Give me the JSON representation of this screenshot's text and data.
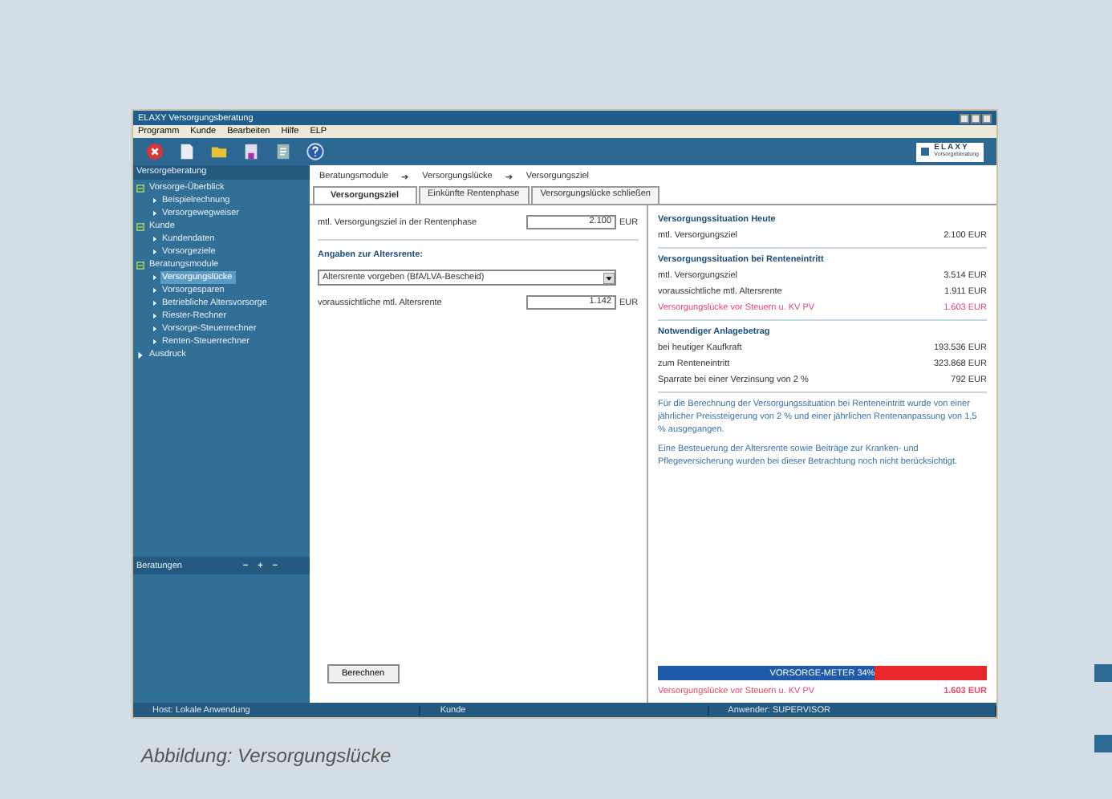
{
  "window": {
    "title": "ELAXY Versorgungsberatung"
  },
  "menu": [
    "Programm",
    "Kunde",
    "Bearbeiten",
    "Hilfe",
    "ELP"
  ],
  "logo": {
    "name": "ELAXY",
    "sub": "Vorsorgeberatung"
  },
  "sidebar": {
    "header": "Versorgeberatung",
    "tree": [
      {
        "label": "Vorsorge-Überblick",
        "expanded": true,
        "children": [
          {
            "label": "Beispielrechnung",
            "selected": false
          },
          {
            "label": "Versorgewegweiser",
            "selected": false
          }
        ]
      },
      {
        "label": "Kunde",
        "expanded": true,
        "children": [
          {
            "label": "Kundendaten",
            "selected": false
          },
          {
            "label": "Vorsorgeziele",
            "selected": false
          }
        ]
      },
      {
        "label": "Beratungsmodule",
        "expanded": true,
        "children": [
          {
            "label": "Versorgungslücke",
            "selected": true
          },
          {
            "label": "Vorsorgesparen",
            "selected": false
          },
          {
            "label": "Betriebliche Altersvorsorge",
            "selected": false
          },
          {
            "label": "Riester-Rechner",
            "selected": false
          },
          {
            "label": "Vorsorge-Steuerrechner",
            "selected": false
          },
          {
            "label": "Renten-Steuerrechner",
            "selected": false
          }
        ]
      },
      {
        "label": "Ausdruck",
        "expanded": false
      }
    ],
    "footer": {
      "label": "Beratungen",
      "controls": [
        "−",
        "+",
        "−"
      ]
    }
  },
  "breadcrumb": [
    "Beratungsmodule",
    "➔",
    "Versorgungslücke",
    "➔",
    "Versorgungsziel"
  ],
  "tabs": [
    {
      "label": "Versorgungsziel",
      "selected": true
    },
    {
      "label": "Einkünfte Rentenphase",
      "selected": false
    },
    {
      "label": "Versorgungslücke schließen",
      "selected": false
    }
  ],
  "form": {
    "target": {
      "label": "mtl. Versorgungsziel in der Rentenphase",
      "value": "2.100",
      "unit": "EUR"
    },
    "section": "Angaben zur Altersrente:",
    "dropdown": {
      "value": "Altersrente vorgeben (BfA/LVA-Bescheid)"
    },
    "pension": {
      "label": "voraussichtliche mtl. Altersrente",
      "value": "1.142",
      "unit": "EUR"
    },
    "button": "Berechnen"
  },
  "summary": [
    {
      "title": "Versorgungssituation Heute",
      "rows": [
        {
          "label": "mtl. Versorgungsziel",
          "value": "2.100 EUR",
          "kind": "normal"
        }
      ]
    },
    {
      "title": "Versorgungssituation bei Renteneintritt",
      "rows": [
        {
          "label": "mtl. Versorgungsziel",
          "value": "3.514 EUR",
          "kind": "normal"
        },
        {
          "label": "voraussichtliche mtl. Altersrente",
          "value": "1.911 EUR",
          "kind": "normal"
        },
        {
          "label": "Versorgungslücke vor Steuern u. KV PV",
          "value": "1.603 EUR",
          "kind": "warning"
        }
      ]
    },
    {
      "title": "Notwendiger Anlagebetrag",
      "rows": [
        {
          "label": "bei heutiger Kaufkraft",
          "value": "193.536 EUR",
          "kind": "normal"
        },
        {
          "label": "zum Renteneintritt",
          "value": "323.868 EUR",
          "kind": "normal"
        },
        {
          "label": "Sparrate bei einer Verzinsung von 2 %",
          "value": "792 EUR",
          "kind": "normal"
        }
      ]
    }
  ],
  "notes": [
    "Für die Berechnung der Versorgungssituation bei Renteneintritt wurde von einer jährlicher Preissteigerung von 2 % und einer jährlichen Rentenanpassung von 1,5 % ausgegangen.",
    "Eine Besteuerung der Altersrente sowie Beiträge zur Kranken- und Pflegeversicherung wurden bei dieser Betrachtung noch nicht berücksichtigt."
  ],
  "meter": {
    "label": "VORSORGE-METER 34%",
    "level": 0.66,
    "gap_label": "Versorgungslücke vor Steuern u. KV PV",
    "gap_value": "1.603 EUR"
  },
  "status_bar": [
    "Host: Lokale Anwendung",
    "Kunde",
    "Anwender: SUPERVISOR"
  ],
  "caption": "Abbildung: Versorgungslücke"
}
